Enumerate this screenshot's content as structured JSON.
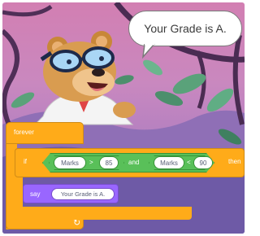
{
  "speech_bubble": {
    "text": "Your Grade is A."
  },
  "blocks": {
    "forever_label": "forever",
    "if_label": "if",
    "then_label": "then",
    "condition": {
      "left": {
        "variable": "Marks",
        "operator": ">",
        "value": "85"
      },
      "joiner": "and",
      "right": {
        "variable": "Marks",
        "operator": "<",
        "value": "90"
      }
    },
    "say": {
      "label": "say",
      "message": "Your Grade is A."
    }
  },
  "colors": {
    "events_orange": "#ffab19",
    "operators_green": "#59c059",
    "looks_purple": "#9966ff"
  },
  "icons": [
    "loop-arrow-icon"
  ]
}
